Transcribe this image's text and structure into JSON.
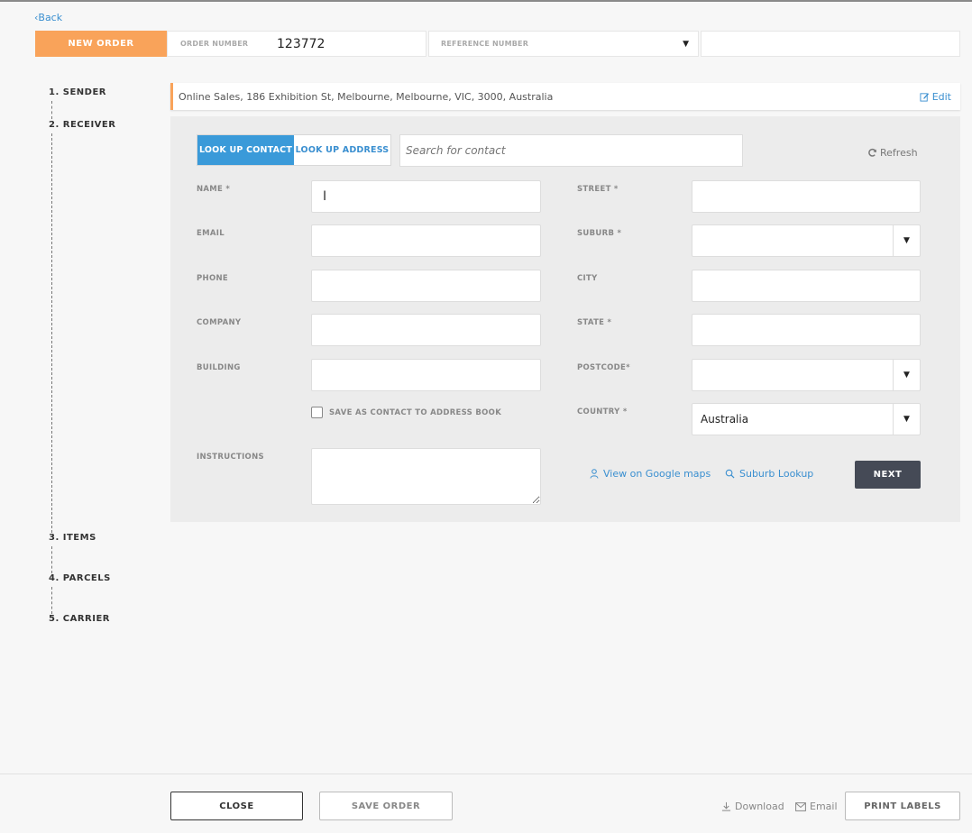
{
  "nav": {
    "back_label": "‹Back"
  },
  "header": {
    "new_order_label": "NEW ORDER",
    "order_number_label": "ORDER NUMBER",
    "order_number_value": "123772",
    "reference_number_label": "REFERENCE NUMBER",
    "reference_input_value": ""
  },
  "steps": [
    {
      "label": "1. SENDER"
    },
    {
      "label": "2. RECEIVER"
    },
    {
      "label": "3. ITEMS"
    },
    {
      "label": "4. PARCELS"
    },
    {
      "label": "5. CARRIER"
    }
  ],
  "sender": {
    "address": "Online Sales, 186 Exhibition St, Melbourne, Melbourne, VIC, 3000, Australia",
    "edit_label": "Edit"
  },
  "receiver": {
    "lookup_contact_label": "LOOK UP CONTACT",
    "lookup_address_label": "LOOK UP ADDRESS",
    "search_placeholder": "Search for contact",
    "refresh_label": "Refresh",
    "fields": {
      "name": {
        "label": "NAME *",
        "value": ""
      },
      "email": {
        "label": "EMAIL",
        "value": ""
      },
      "phone": {
        "label": "PHONE",
        "value": ""
      },
      "company": {
        "label": "COMPANY",
        "value": ""
      },
      "building": {
        "label": "BUILDING",
        "value": ""
      },
      "instructions": {
        "label": "INSTRUCTIONS",
        "value": ""
      },
      "street": {
        "label": "STREET *",
        "value": ""
      },
      "suburb": {
        "label": "SUBURB *",
        "value": ""
      },
      "city": {
        "label": "CITY",
        "value": ""
      },
      "state": {
        "label": "STATE *",
        "value": ""
      },
      "postcode": {
        "label": "POSTCODE*",
        "value": ""
      },
      "country": {
        "label": "COUNTRY *",
        "value": "Australia"
      }
    },
    "save_contact_label": "SAVE AS CONTACT TO ADDRESS BOOK",
    "view_maps_label": "View on Google maps",
    "suburb_lookup_label": "Suburb Lookup",
    "next_label": "NEXT"
  },
  "footer": {
    "close_label": "CLOSE",
    "save_order_label": "SAVE ORDER",
    "download_label": "Download",
    "email_label": "Email",
    "print_labels_label": "PRINT LABELS"
  },
  "colors": {
    "accent_orange": "#f9a35a",
    "accent_blue": "#3a9ad9",
    "link_blue": "#3a8fd0",
    "next_button": "#454a56"
  }
}
